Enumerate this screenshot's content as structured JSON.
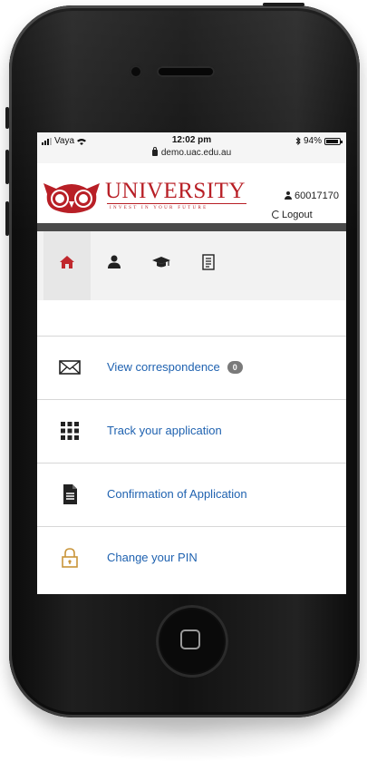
{
  "status_bar": {
    "carrier": "Vaya",
    "time": "12:02 pm",
    "url": "demo.uac.edu.au",
    "battery": "94%",
    "battery_level": 0.94,
    "icons": [
      "signal-icon",
      "wifi-icon",
      "lock-icon",
      "bluetooth-icon",
      "battery-icon"
    ]
  },
  "header": {
    "brand": "UNIVERSITY",
    "tagline": "INVEST IN YOUR FUTURE",
    "user_id": "60017170",
    "logout_label": "Logout",
    "brand_color": "#b81f26"
  },
  "tabs": [
    {
      "icon": "home-icon",
      "active": true
    },
    {
      "icon": "user-icon",
      "active": false
    },
    {
      "icon": "graduation-cap-icon",
      "active": false
    },
    {
      "icon": "document-list-icon",
      "active": false
    }
  ],
  "menu": [
    {
      "label": "View correspondence",
      "icon": "envelope-icon",
      "badge": "0"
    },
    {
      "label": "Track your application",
      "icon": "grid-icon"
    },
    {
      "label": "Confirmation of Application",
      "icon": "document-icon"
    },
    {
      "label": "Change your PIN",
      "icon": "padlock-icon"
    }
  ],
  "colors": {
    "link": "#1f62b0",
    "active_tab_icon": "#c0282d",
    "dark_bar": "#4a4a4a"
  }
}
